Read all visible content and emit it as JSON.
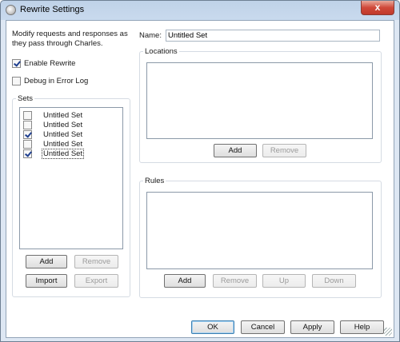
{
  "window": {
    "title": "Rewrite Settings",
    "close_glyph": "x"
  },
  "left": {
    "description": "Modify requests and responses as they pass through Charles.",
    "enable_rewrite": {
      "label": "Enable Rewrite",
      "checked": true
    },
    "debug_log": {
      "label": "Debug in Error Log",
      "checked": false
    },
    "sets_label": "Sets",
    "sets": [
      {
        "name": "Untitled Set",
        "checked": false
      },
      {
        "name": "Untitled Set",
        "checked": false
      },
      {
        "name": "Untitled Set",
        "checked": true
      },
      {
        "name": "Untitled Set",
        "checked": false
      },
      {
        "name": "Untitled Set",
        "checked": true
      }
    ],
    "buttons": {
      "add": "Add",
      "remove": "Remove",
      "import": "Import",
      "export": "Export"
    }
  },
  "right": {
    "name_label": "Name:",
    "name_value": "Untitled Set",
    "locations_label": "Locations",
    "locations_buttons": {
      "add": "Add",
      "remove": "Remove"
    },
    "rules_label": "Rules",
    "rules_buttons": {
      "add": "Add",
      "remove": "Remove",
      "up": "Up",
      "down": "Down"
    }
  },
  "footer": {
    "ok": "OK",
    "cancel": "Cancel",
    "apply": "Apply",
    "help": "Help"
  }
}
